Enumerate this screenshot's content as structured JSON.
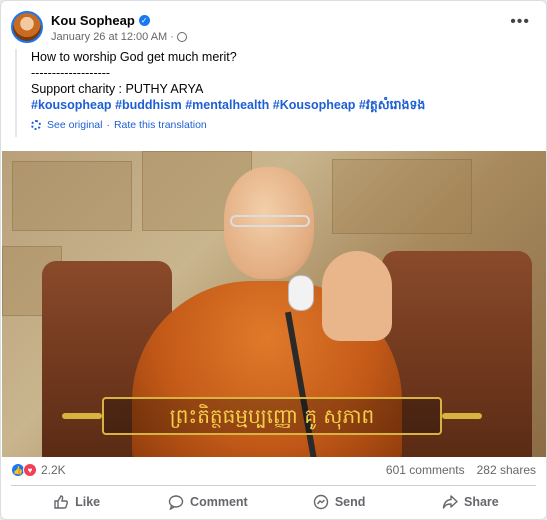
{
  "post": {
    "author": "Kou Sopheap",
    "timestamp": "January 26 at 12:00 AM",
    "separator": "·",
    "lines": [
      "How to worship God get much merit?",
      "-------------------",
      "Support charity : PUTHY ARYA"
    ],
    "hashtags": [
      "#kousopheap",
      "#buddhism",
      "#mentalhealth",
      "#Kousopheap",
      "#វត្តសំរោងទង"
    ],
    "see_original": "See original",
    "rate_translation": "Rate this translation",
    "dot": "·",
    "banner_text": "ព្រះតិត្ថធម្មប្បញ្ញោ គូ សុភាព"
  },
  "stats": {
    "reactions_count": "2.2K",
    "comments": "601 comments",
    "shares": "282 shares"
  },
  "actions": {
    "like": "Like",
    "comment": "Comment",
    "send": "Send",
    "share": "Share"
  },
  "icons": {
    "verified": "verified-badge-icon",
    "globe": "globe-icon",
    "more": "more-icon",
    "gear": "gear-icon",
    "like_reaction": "like-reaction-icon",
    "love_reaction": "love-reaction-icon"
  },
  "colors": {
    "brand_blue": "#1877f2",
    "link_blue": "#1d5fd6",
    "love_red": "#f33e58",
    "meta_gray": "#65676b"
  }
}
